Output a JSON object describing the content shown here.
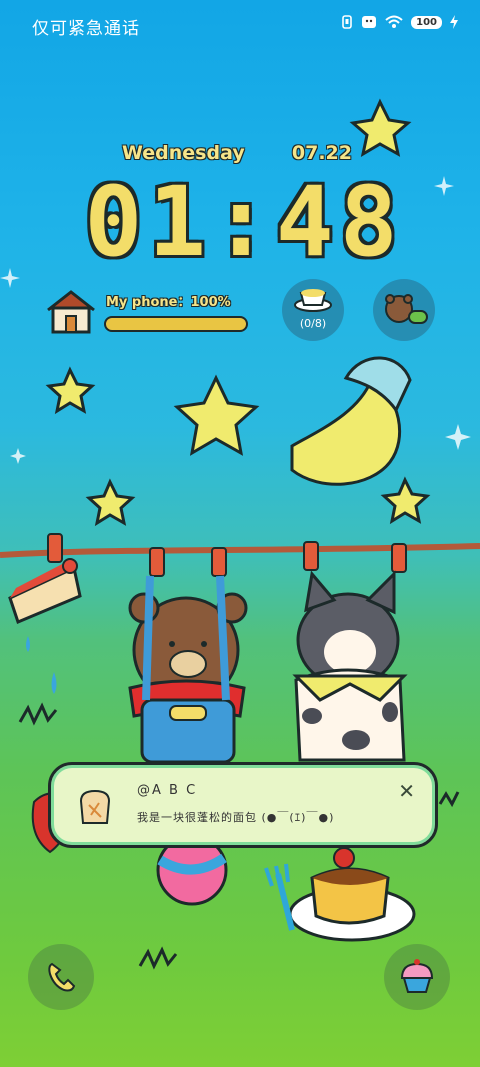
{
  "status_bar": {
    "carrier_text": "仅可紧急通话",
    "battery": "100"
  },
  "lock": {
    "weekday": "Wednesday",
    "date": "07.22",
    "time": "01:48"
  },
  "widget": {
    "phone_label": "My phone：",
    "phone_percent": "100%",
    "phone_level": 1.0
  },
  "bubble": {
    "count": "(0/8)"
  },
  "notification": {
    "title": "@A B C",
    "body": "我是一块很蓬松的面包 (●￣(ｴ)￣●)"
  },
  "colors": {
    "accent_yellow": "#f3dd69",
    "outline": "#1c2a2a",
    "sky_top": "#12a6e6",
    "grass": "#7ecf35"
  }
}
